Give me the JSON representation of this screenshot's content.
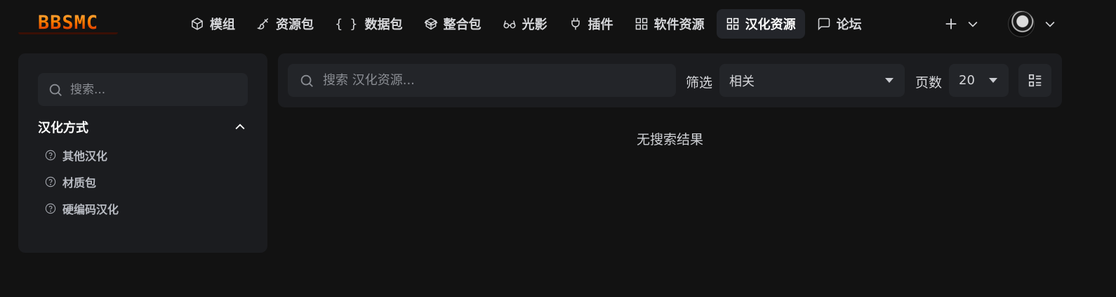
{
  "logo": {
    "text": "BBSMC",
    "icon": "bbsmc-logo"
  },
  "nav": {
    "items": [
      {
        "label": "模组",
        "icon": "cube-icon"
      },
      {
        "label": "资源包",
        "icon": "paintbrush-icon"
      },
      {
        "label": "数据包",
        "icon": "braces-icon"
      },
      {
        "label": "整合包",
        "icon": "package-icon"
      },
      {
        "label": "光影",
        "icon": "glasses-icon"
      },
      {
        "label": "插件",
        "icon": "plug-icon"
      },
      {
        "label": "软件资源",
        "icon": "grid-icon"
      },
      {
        "label": "汉化资源",
        "icon": "grid-icon",
        "active": true
      },
      {
        "label": "论坛",
        "icon": "message-icon"
      }
    ],
    "create_icon": "plus-icon",
    "dropdown_icon": "chevron-down-icon",
    "avatar_icon": "user-avatar"
  },
  "sidebar": {
    "search_placeholder": "搜索...",
    "section_title": "汉化方式",
    "section_icon": "chevron-up-icon",
    "filters": [
      {
        "label": "其他汉化",
        "icon": "help-circle-icon"
      },
      {
        "label": "材质包",
        "icon": "help-circle-icon"
      },
      {
        "label": "硬编码汉化",
        "icon": "help-circle-icon"
      }
    ]
  },
  "toolbar": {
    "search_placeholder": "搜索 汉化资源...",
    "sort_label": "筛选",
    "sort_value": "相关",
    "page_size_label": "页数",
    "page_size_value": "20",
    "layout_icon": "list-layout-icon"
  },
  "results": {
    "empty_text": "无搜索结果"
  },
  "colors": {
    "background": "#121212",
    "panel": "#1b1c1f",
    "input": "#232529",
    "active_nav": "#23252a"
  }
}
